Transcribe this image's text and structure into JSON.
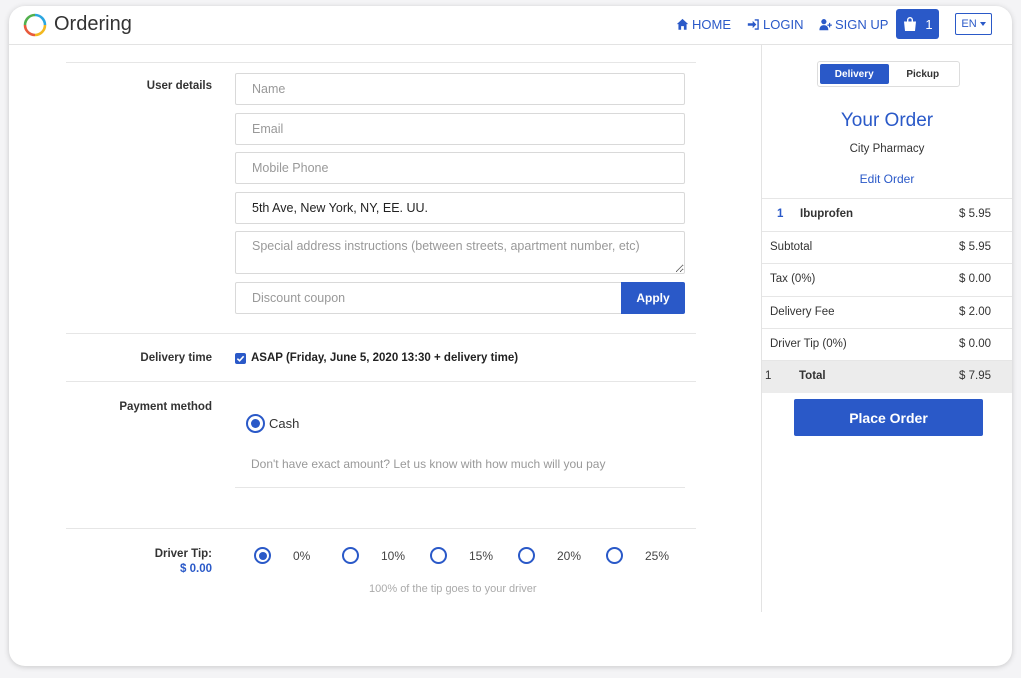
{
  "header": {
    "brand": "Ordering",
    "nav": {
      "home": "HOME",
      "login": "LOGIN",
      "signup": "SIGN UP"
    },
    "cart_count": "1",
    "language": "EN"
  },
  "form": {
    "user_details_label": "User details",
    "name_placeholder": "Name",
    "email_placeholder": "Email",
    "phone_placeholder": "Mobile Phone",
    "address_value": "5th Ave, New York, NY, EE. UU.",
    "instructions_placeholder": "Special address instructions (between streets, apartment number, etc)",
    "coupon_placeholder": "Discount coupon",
    "apply_label": "Apply",
    "delivery_time_label": "Delivery time",
    "asap_text": "ASAP (Friday, June 5, 2020 13:30 + delivery time)",
    "payment_label": "Payment method",
    "cash_label": "Cash",
    "cash_hint": "Don't have exact amount? Let us know with how much will you pay",
    "tip_label": "Driver Tip:",
    "tip_amount": "$ 0.00",
    "tip_options": [
      "0%",
      "10%",
      "15%",
      "20%",
      "25%"
    ],
    "tip_selected": "0%",
    "tip_note": "100% of the tip goes to your driver"
  },
  "order": {
    "mode_delivery": "Delivery",
    "mode_pickup": "Pickup",
    "title": "Your Order",
    "store": "City Pharmacy",
    "edit_label": "Edit Order",
    "item": {
      "qty": "1",
      "name": "Ibuprofen",
      "price": "$ 5.95"
    },
    "subtotal_label": "Subtotal",
    "subtotal": "$ 5.95",
    "tax_label": "Tax (0%)",
    "tax": "$ 0.00",
    "delivery_fee_label": "Delivery Fee",
    "delivery_fee": "$ 2.00",
    "driver_tip_label": "Driver Tip (0%)",
    "driver_tip": "$ 0.00",
    "total_qty": "1",
    "total_label": "Total",
    "total": "$ 7.95",
    "place_order_label": "Place Order"
  },
  "colors": {
    "accent": "#2a59c8"
  }
}
